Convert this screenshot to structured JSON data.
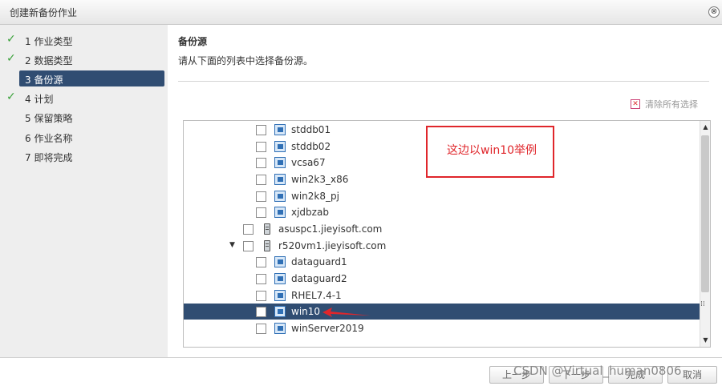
{
  "window": {
    "title": "创建新备份作业",
    "close_glyph": "⊗"
  },
  "steps": [
    {
      "label": "1  作业类型",
      "done": true
    },
    {
      "label": "2  数据类型",
      "done": true
    },
    {
      "label": "3  备份源",
      "active": true
    },
    {
      "label": "4  计划",
      "done": true
    },
    {
      "label": "5  保留策略"
    },
    {
      "label": "6  作业名称"
    },
    {
      "label": "7  即将完成"
    }
  ],
  "main": {
    "title": "备份源",
    "description": "请从下面的列表中选择备份源。",
    "clear_all_label": "清除所有选择"
  },
  "tree": {
    "rows": [
      {
        "label": "stddb01",
        "type": "vm"
      },
      {
        "label": "stddb02",
        "type": "vm"
      },
      {
        "label": "vcsa67",
        "type": "vm"
      },
      {
        "label": "win2k3_x86",
        "type": "vm"
      },
      {
        "label": "win2k8_pj",
        "type": "vm"
      },
      {
        "label": "xjdbzab",
        "type": "vm"
      },
      {
        "label": "asuspc1.jieyisoft.com",
        "type": "host"
      },
      {
        "label": "r520vm1.jieyisoft.com",
        "type": "host",
        "expanded": true
      },
      {
        "label": "dataguard1",
        "type": "vm"
      },
      {
        "label": "dataguard2",
        "type": "vm"
      },
      {
        "label": "RHEL7.4-1",
        "type": "vm"
      },
      {
        "label": "win10",
        "type": "vm",
        "selected": true
      },
      {
        "label": "winServer2019",
        "type": "vm"
      }
    ]
  },
  "annotation": {
    "text": "这边以win10举例",
    "color": "#e0262b"
  },
  "footer": {
    "buttons": [
      "上一步",
      "下一步",
      "完成",
      "取消"
    ],
    "watermark": "CSDN @Virtual_human0806"
  },
  "colors": {
    "selected_bg": "#304d72",
    "check": "#3aa13a"
  }
}
